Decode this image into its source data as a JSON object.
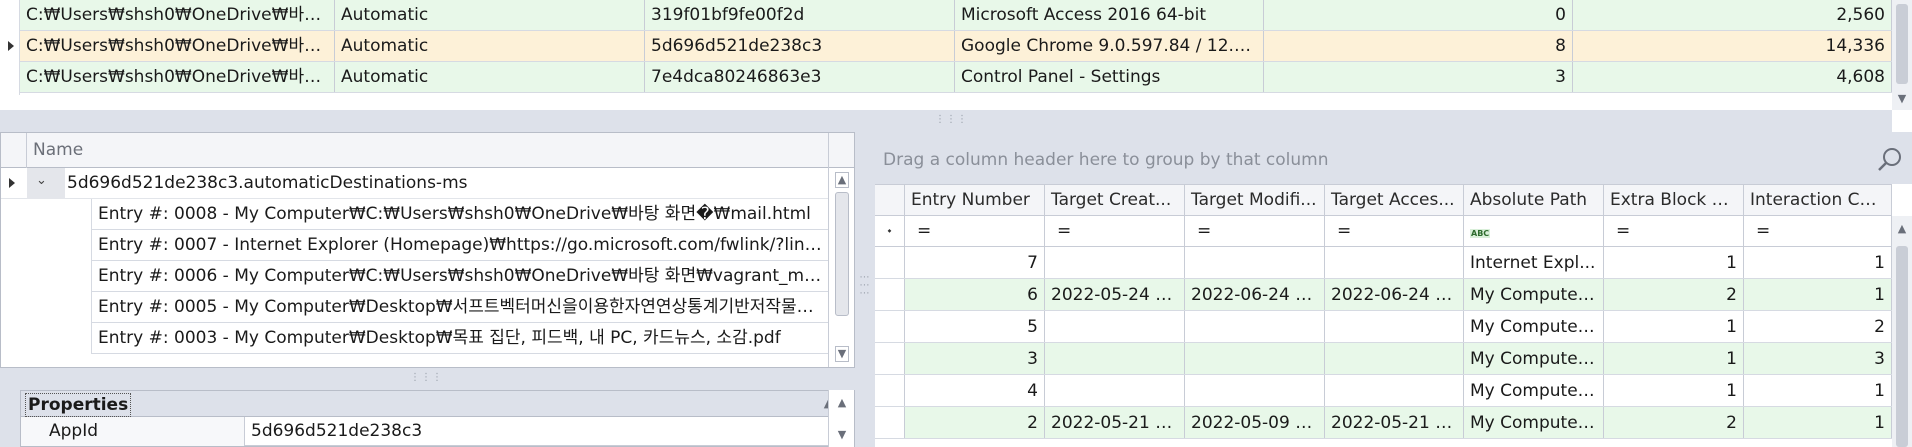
{
  "top_grid": {
    "rows": [
      {
        "path": "C:₩Users₩shsh0₩OneDrive₩바탕...",
        "mode": "Automatic",
        "app_id": "319f01bf9fe00f2d",
        "desc": "Microsoft Access 2016 64-bit",
        "count": "0",
        "size": "2,560",
        "style": "green"
      },
      {
        "path": "C:₩Users₩shsh0₩OneDrive₩바탕...",
        "mode": "Automatic",
        "app_id": "5d696d521de238c3",
        "desc": "Google Chrome 9.0.597.84 / 12.0...",
        "count": "8",
        "size": "14,336",
        "style": "sel"
      },
      {
        "path": "C:₩Users₩shsh0₩OneDrive₩바탕...",
        "mode": "Automatic",
        "app_id": "7e4dca80246863e3",
        "desc": "Control Panel - Settings",
        "count": "3",
        "size": "4,608",
        "style": "green"
      }
    ]
  },
  "tree": {
    "header": "Name",
    "root": "5d696d521de238c3.automaticDestinations-ms",
    "entries": [
      "Entry #: 0008 - My Computer₩C:₩Users₩shsh0₩OneDrive₩바탕 화면�₩mail.html",
      "Entry #: 0007 - Internet Explorer (Homepage)₩https://go.microsoft.com/fwlink/?link...",
      "Entry #: 0006 - My Computer₩C:₩Users₩shsh0₩OneDrive₩바탕 화면₩vagrant_multi...",
      "Entry #: 0005 - My Computer₩Desktop₩서프트벡터머신을이용한자연연상통계기반저작물식별...",
      "Entry #: 0003 - My Computer₩Desktop₩목표 집단, 피드백, 내 PC, 카드뉴스, 소감.pdf"
    ]
  },
  "properties": {
    "title": "Properties",
    "rows": [
      {
        "key": "AppId",
        "value": "5d696d521de238c3"
      }
    ]
  },
  "entries_grid": {
    "group_hint": "Drag a column header here to group by that column",
    "columns": [
      "Entry Number",
      "Target Creat...",
      "Target Modifi...",
      "Target Acces...",
      "Absolute Path",
      "Extra Block C...",
      "Interaction Co..."
    ],
    "filter_eq": "=",
    "filter_abc": "ABC",
    "rows": [
      {
        "n": "7",
        "c": "",
        "m": "",
        "a": "",
        "p": "Internet Expl...",
        "e": "1",
        "i": "1",
        "style": ""
      },
      {
        "n": "6",
        "c": "2022-05-24 0...",
        "m": "2022-06-24 0...",
        "a": "2022-06-24 0...",
        "p": "My Computer...",
        "e": "2",
        "i": "1",
        "style": "green"
      },
      {
        "n": "5",
        "c": "",
        "m": "",
        "a": "",
        "p": "My Computer...",
        "e": "1",
        "i": "2",
        "style": ""
      },
      {
        "n": "3",
        "c": "",
        "m": "",
        "a": "",
        "p": "My Computer...",
        "e": "1",
        "i": "3",
        "style": "green"
      },
      {
        "n": "4",
        "c": "",
        "m": "",
        "a": "",
        "p": "My Computer...",
        "e": "1",
        "i": "1",
        "style": ""
      },
      {
        "n": "2",
        "c": "2022-05-21 1...",
        "m": "2022-05-09 0...",
        "a": "2022-05-21 1...",
        "p": "My Computer...",
        "e": "2",
        "i": "1",
        "style": "green"
      }
    ]
  },
  "colors": {
    "row_green": "#e8f8e9",
    "row_selected": "#fdf1d8",
    "panel_bg": "#dde1ea",
    "header_bg": "#f4f5f8"
  }
}
